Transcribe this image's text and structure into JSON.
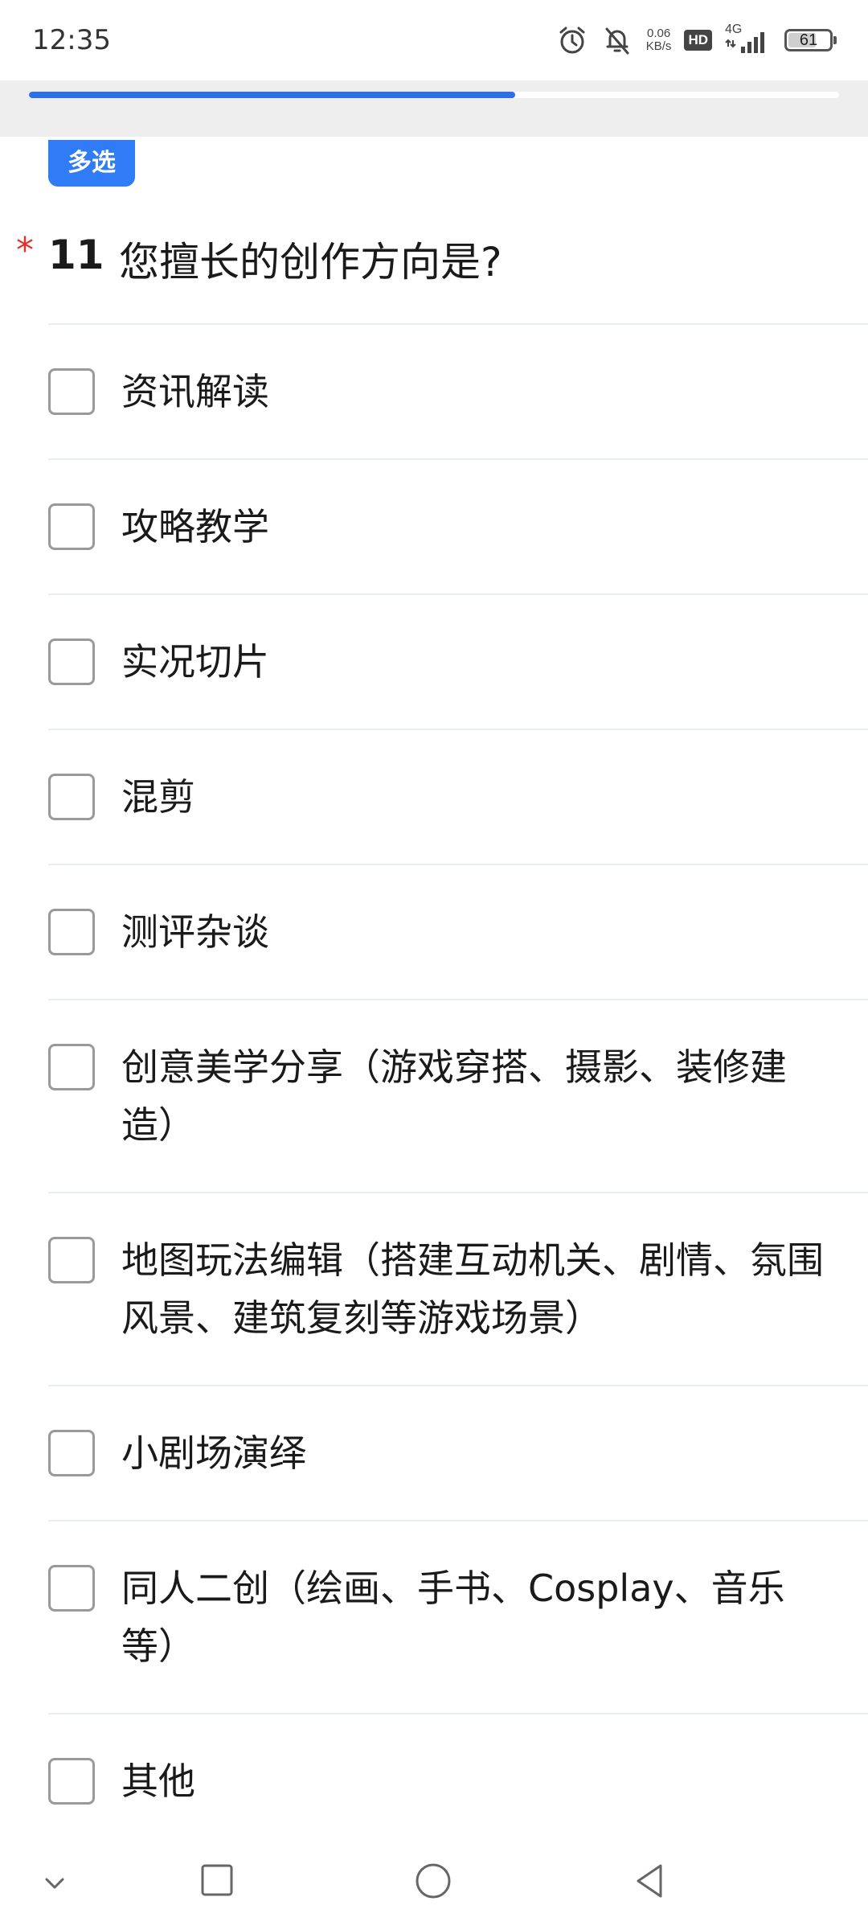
{
  "status_bar": {
    "time": "12:35",
    "net_speed_value": "0.06",
    "net_speed_unit": "KB/s",
    "hd_label": "HD",
    "network_type": "4G",
    "battery": "61",
    "icons": [
      "alarm-icon",
      "bell-muted-icon",
      "hd-icon",
      "signal-icon",
      "battery-icon"
    ]
  },
  "progress": {
    "fraction": 0.6
  },
  "question": {
    "type_badge": "多选",
    "required_mark": "*",
    "number": "11",
    "text": "您擅长的创作方向是?",
    "options": [
      {
        "label": "资讯解读",
        "checked": false
      },
      {
        "label": "攻略教学",
        "checked": false
      },
      {
        "label": "实况切片",
        "checked": false
      },
      {
        "label": "混剪",
        "checked": false
      },
      {
        "label": "测评杂谈",
        "checked": false
      },
      {
        "label": "创意美学分享（游戏穿搭、摄影、装修建造）",
        "checked": false
      },
      {
        "label": "地图玩法编辑（搭建互动机关、剧情、氛围风景、建筑复刻等游戏场景）",
        "checked": false
      },
      {
        "label": "小剧场演绎",
        "checked": false
      },
      {
        "label": "同人二创（绘画、手书、Cosplay、音乐等）",
        "checked": false
      },
      {
        "label": "其他",
        "checked": false
      }
    ]
  },
  "nav_bar": {
    "icons": [
      "chevron-down-icon",
      "recents-square-icon",
      "home-circle-icon",
      "back-triangle-icon"
    ]
  },
  "colors": {
    "accent": "#2f7cf6",
    "progress": "#2f6fe4",
    "required": "#e0322b",
    "divider": "#e6eef0",
    "checkbox_border": "#9a9a9a"
  }
}
